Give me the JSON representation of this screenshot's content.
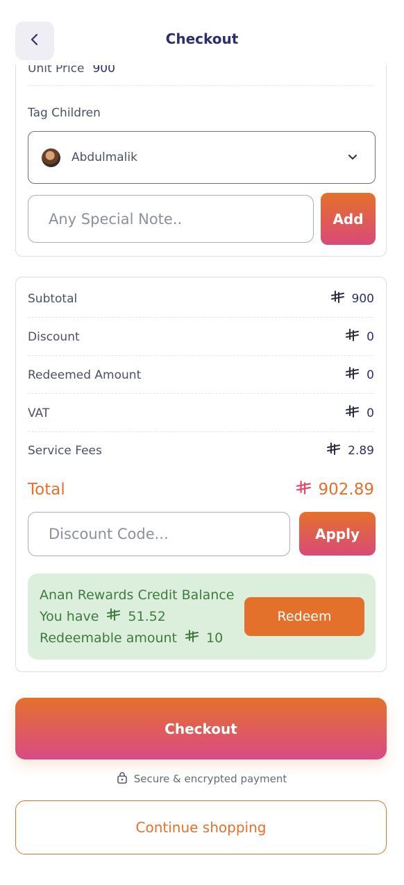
{
  "header": {
    "title": "Checkout",
    "back_icon": "chevron-left-icon"
  },
  "item": {
    "unit_price_label": "Unit Price",
    "unit_price_value": "900",
    "tag_children_label": "Tag Children",
    "selected_child": "Abdulmalik",
    "note_placeholder": "Any Special Note..",
    "add_label": "Add"
  },
  "summary": {
    "subtotal_label": "Subtotal",
    "subtotal_value": "900",
    "discount_label": "Discount",
    "discount_value": "0",
    "redeemed_label": "Redeemed Amount",
    "redeemed_value": "0",
    "vat_label": "VAT",
    "vat_value": "0",
    "fees_label": "Service Fees",
    "fees_value": "2.89",
    "total_label": "Total",
    "total_value": "902.89",
    "currency_icon": "riyal-icon"
  },
  "discount": {
    "placeholder": "Discount Code...",
    "apply_label": "Apply"
  },
  "rewards": {
    "title": "Anan Rewards Credit Balance",
    "balance_label": "You have",
    "balance_value": "51.52",
    "redeemable_label": "Redeemable amount",
    "redeemable_value": "10",
    "redeem_label": "Redeem"
  },
  "actions": {
    "checkout_label": "Checkout",
    "secure_text": "Secure & encrypted payment",
    "continue_label": "Continue shopping"
  },
  "colors": {
    "accent": "#e4712b",
    "accent_pink": "#d94a78",
    "title": "#2e2e6e",
    "rewards_bg": "#dcefdc",
    "rewards_text": "#3f7a3f"
  }
}
